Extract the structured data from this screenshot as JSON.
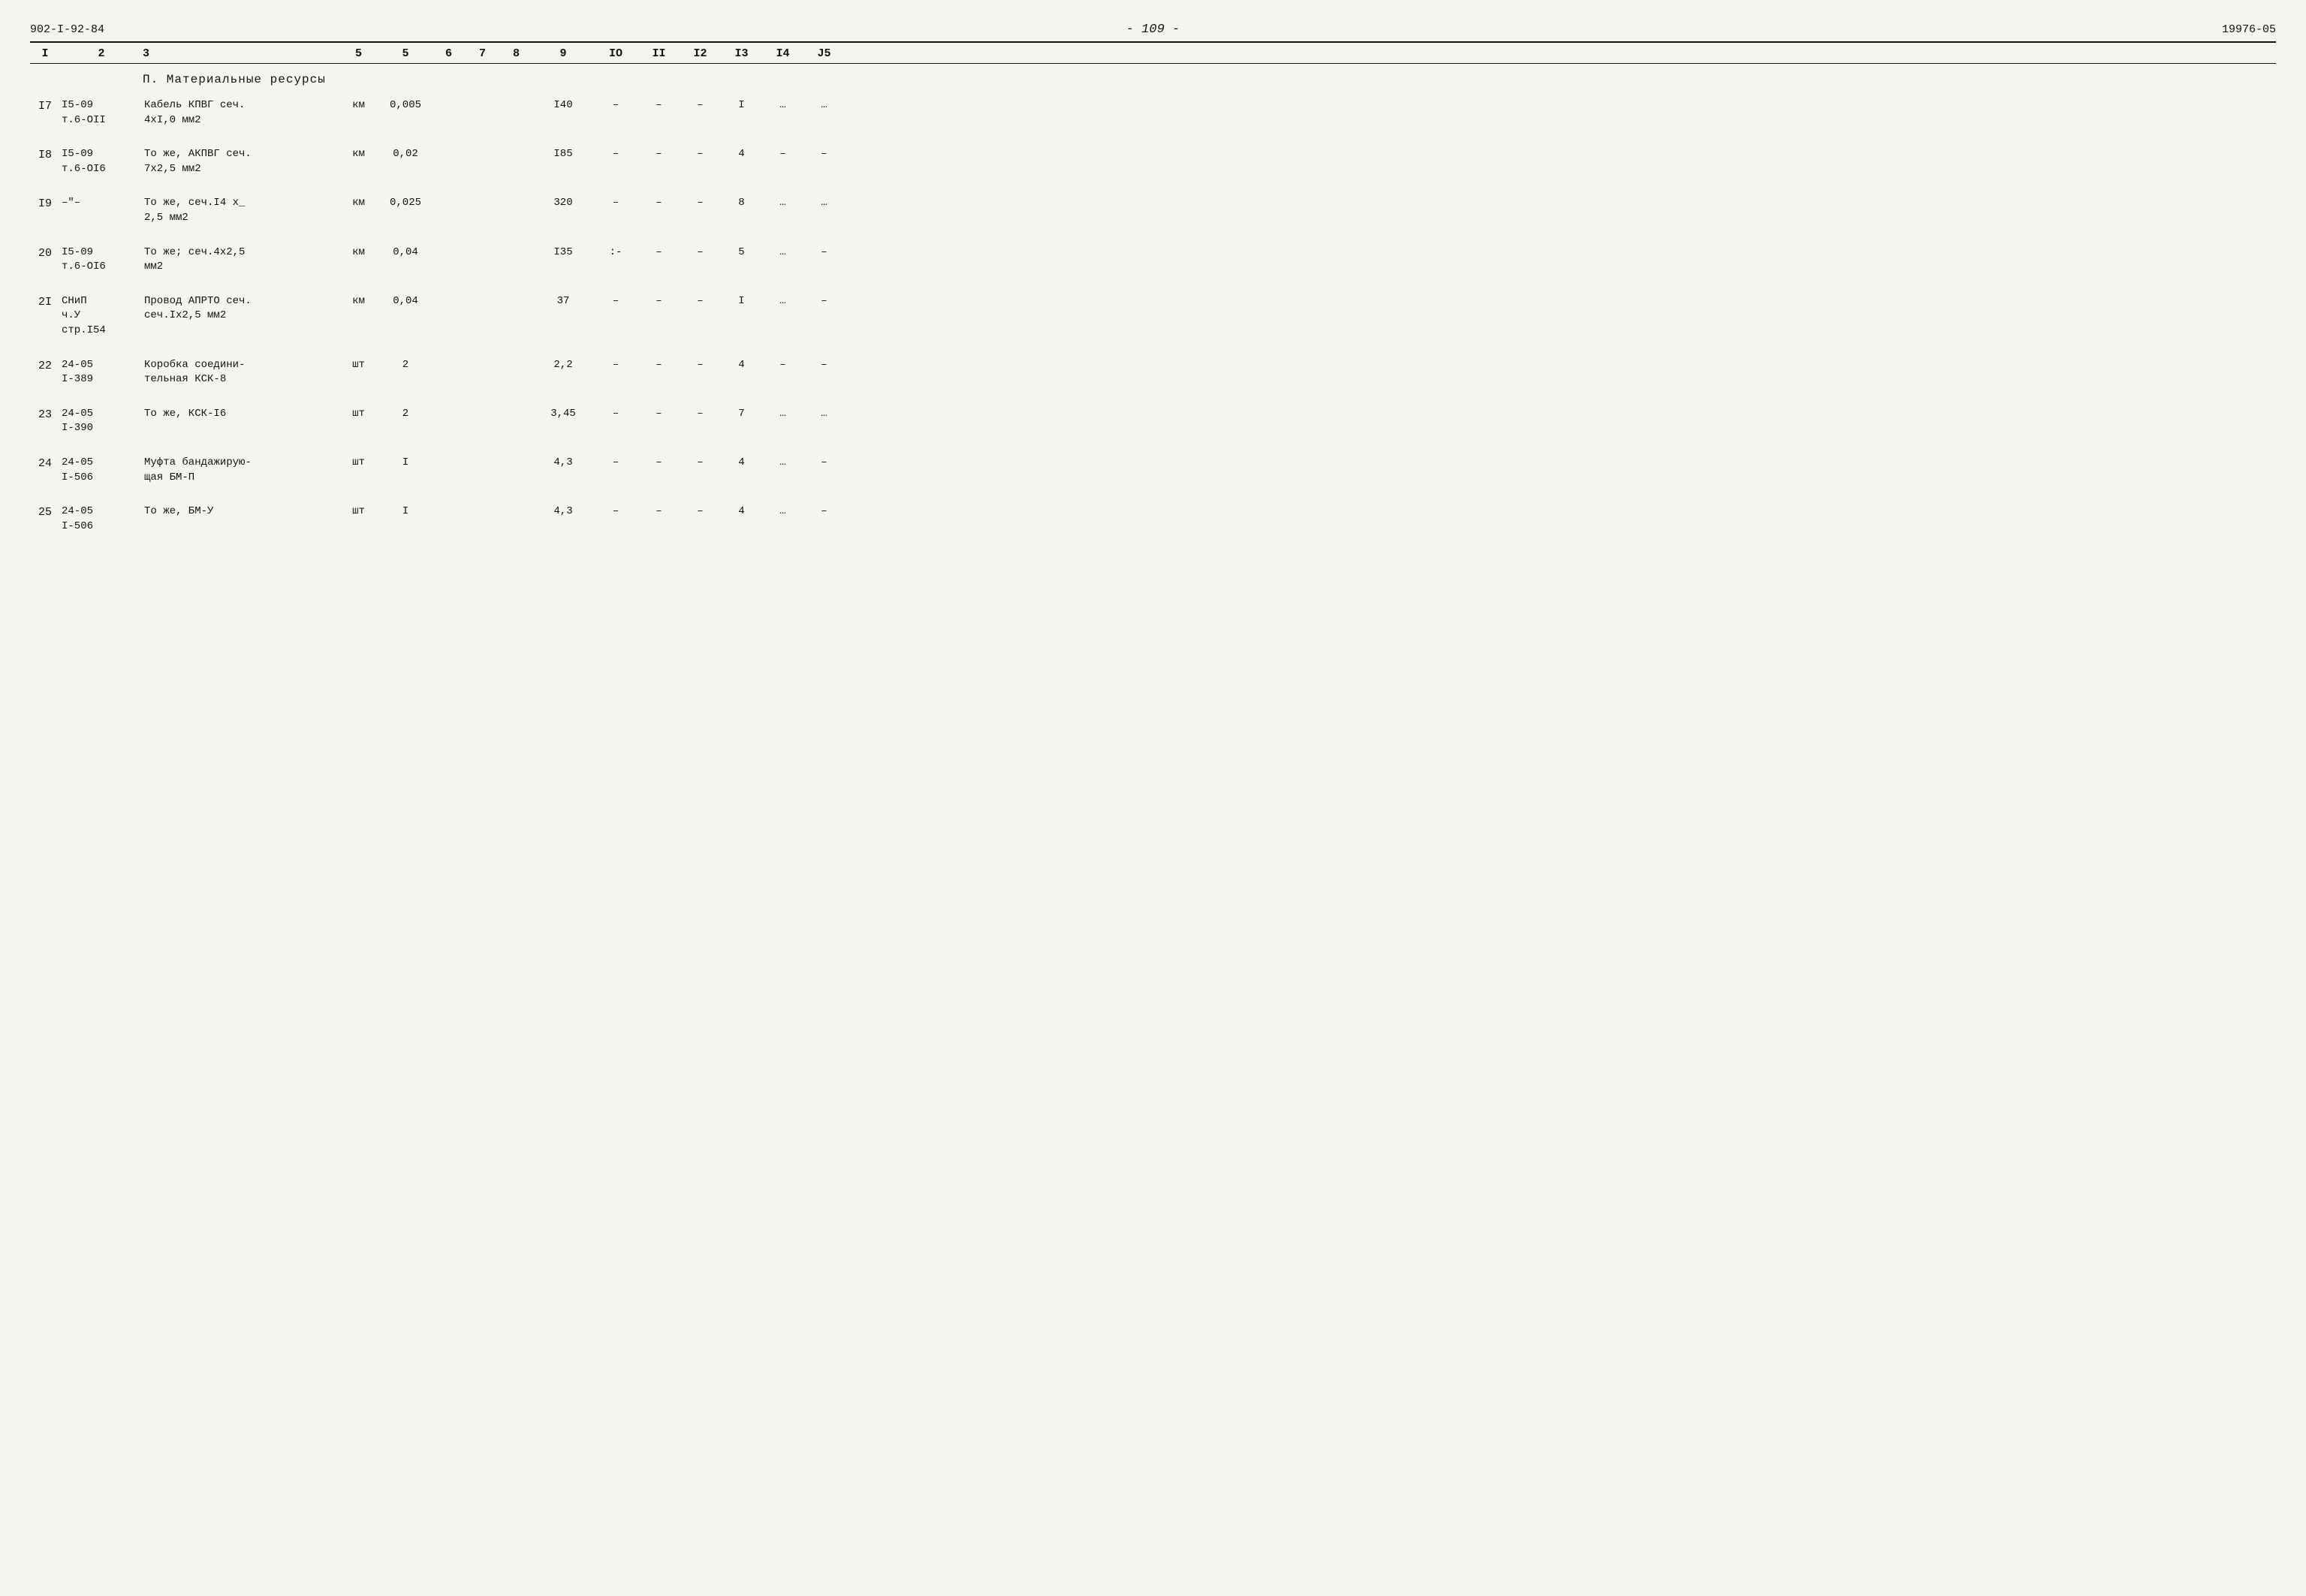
{
  "header": {
    "left": "902-I-92-84",
    "center": "- 109 -",
    "right": "19976-05"
  },
  "columns": [
    "I",
    "2",
    "3",
    "5",
    "5",
    "6",
    "7",
    "8",
    "9",
    "IO",
    "II",
    "I2",
    "I3",
    "I4",
    "J5"
  ],
  "section_title": "П. Материальные ресурсы",
  "rows": [
    {
      "num": "I7",
      "code": "I5-09\nт.6-OII",
      "desc": "Кабель КПВГ сеч.\n4xI,0 мм2",
      "unit": "км",
      "col5": "0,005",
      "col6": "",
      "col7": "",
      "col8": "",
      "col9": "I40",
      "col10": "–",
      "col11": "–",
      "col12": "–",
      "col13": "I",
      "col14": "…",
      "col15": "…"
    },
    {
      "num": "I8",
      "code": "I5-09\nт.6-OI6",
      "desc": "То же, АКПВГ сеч.\n7x2,5 мм2",
      "unit": "км",
      "col5": "0,02",
      "col6": "",
      "col7": "",
      "col8": "",
      "col9": "I85",
      "col10": "–",
      "col11": "–",
      "col12": "–",
      "col13": "4",
      "col14": "–",
      "col15": "–"
    },
    {
      "num": "I9",
      "code": "–\"–",
      "desc": "То же, сеч.I4 х_\n2,5 мм2",
      "unit": "км",
      "col5": "0,025",
      "col6": "",
      "col7": "",
      "col8": "",
      "col9": "320",
      "col10": "–",
      "col11": "–",
      "col12": "–",
      "col13": "8",
      "col14": "…",
      "col15": "…"
    },
    {
      "num": "20",
      "code": "I5-09\nт.6-OI6",
      "desc": "То же; сеч.4x2,5\nмм2",
      "unit": "км",
      "col5": "0,04",
      "col6": "",
      "col7": "",
      "col8": "",
      "col9": "I35",
      "col10": ":-",
      "col11": "–",
      "col12": "–",
      "col13": "5",
      "col14": "…",
      "col15": "–"
    },
    {
      "num": "2I",
      "code": "СНиП\nч.У\nстр.I54",
      "desc": "Провод АПРТО сеч.\nсеч.Iх2,5 мм2",
      "unit": "км",
      "col5": "0,04",
      "col6": "",
      "col7": "",
      "col8": "",
      "col9": "37",
      "col10": "–",
      "col11": "–",
      "col12": "–",
      "col13": "I",
      "col14": "…",
      "col15": "–"
    },
    {
      "num": "22",
      "code": "24-05\nI-389",
      "desc": "Коробка соедини-\nтельная КСК-8",
      "unit": "шт",
      "col5": "2",
      "col6": "",
      "col7": "",
      "col8": "",
      "col9": "2,2",
      "col10": "–",
      "col11": "–",
      "col12": "–",
      "col13": "4",
      "col14": "–",
      "col15": "–"
    },
    {
      "num": "23",
      "code": "24-05\nI-390",
      "desc": "То же, КСК-I6",
      "unit": "шт",
      "col5": "2",
      "col6": "",
      "col7": "",
      "col8": "",
      "col9": "3,45",
      "col10": "–",
      "col11": "–",
      "col12": "–",
      "col13": "7",
      "col14": "…",
      "col15": "…"
    },
    {
      "num": "24",
      "code": "24-05\nI-506",
      "desc": "Муфта бандажирую-\nщая БМ-П",
      "unit": "шт",
      "col5": "I",
      "col6": "",
      "col7": "",
      "col8": "",
      "col9": "4,3",
      "col10": "–",
      "col11": "–",
      "col12": "–",
      "col13": "4",
      "col14": "…",
      "col15": "–"
    },
    {
      "num": "25",
      "code": "24-05\nI-506",
      "desc": "То же, БМ-У",
      "unit": "шт",
      "col5": "I",
      "col6": "",
      "col7": "",
      "col8": "",
      "col9": "4,3",
      "col10": "–",
      "col11": "–",
      "col12": "–",
      "col13": "4",
      "col14": "…",
      "col15": "–"
    }
  ]
}
